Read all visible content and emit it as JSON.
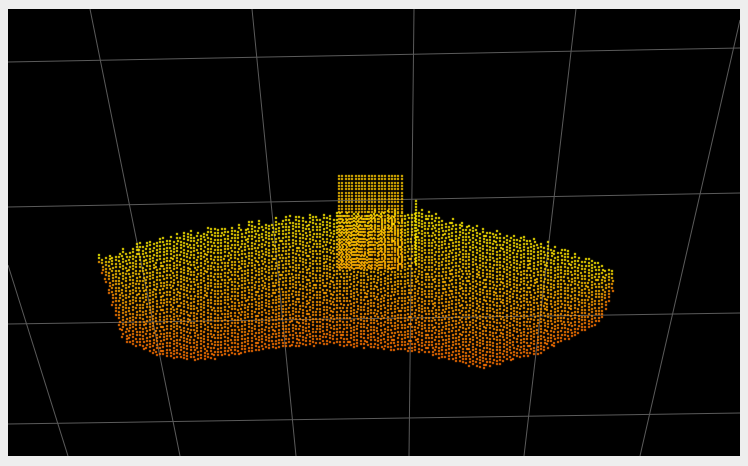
{
  "viewer": {
    "background_color": "#000000",
    "grid_color": "#5a5a5a",
    "frame_color": "#eeeeee",
    "point_colors": {
      "top": "#ffff00",
      "bottom": "#ff7000"
    }
  }
}
